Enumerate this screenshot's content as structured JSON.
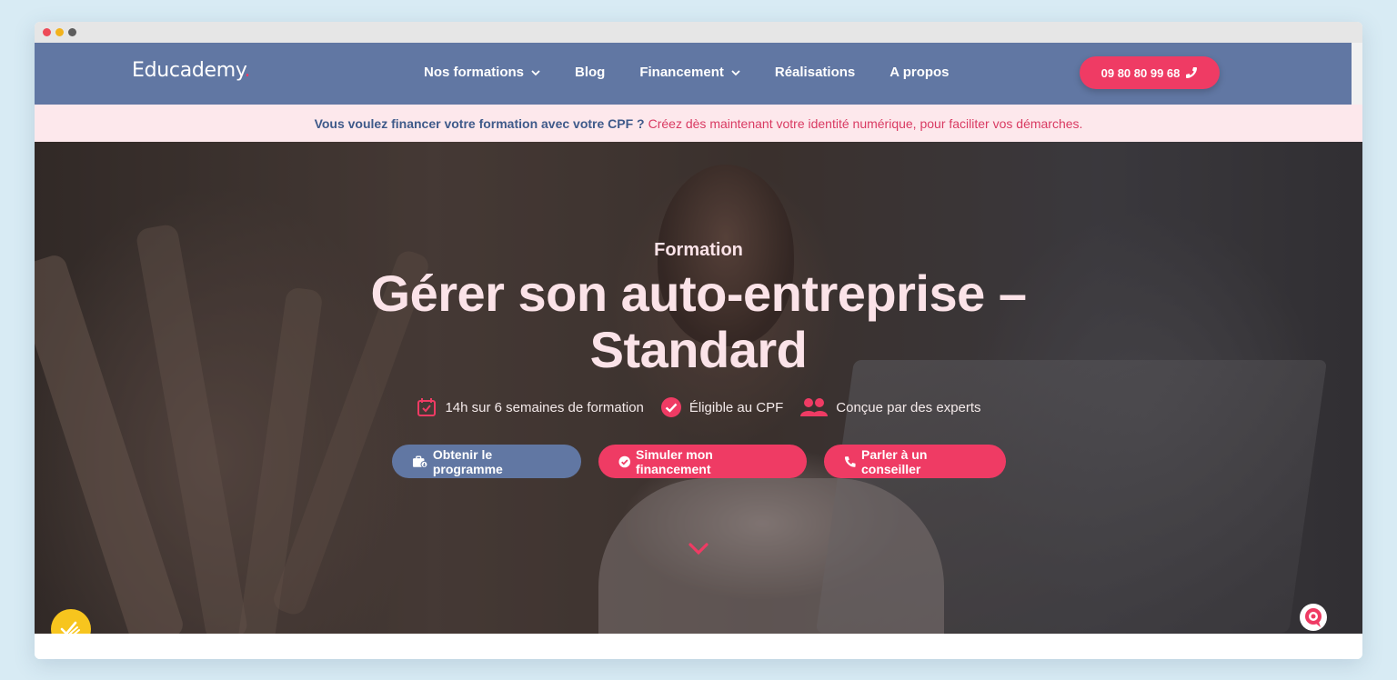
{
  "window": {
    "controls": [
      "close",
      "minimize",
      "maximize"
    ]
  },
  "nav": {
    "logo_text": "Educademy",
    "logo_dot": ".",
    "items": [
      {
        "label": "Nos formations",
        "has_dropdown": true
      },
      {
        "label": "Blog",
        "has_dropdown": false
      },
      {
        "label": "Financement",
        "has_dropdown": true
      },
      {
        "label": "Réalisations",
        "has_dropdown": false
      },
      {
        "label": "A propos",
        "has_dropdown": false
      }
    ],
    "phone": "09 80 80 99 68"
  },
  "banner": {
    "question": "Vous voulez financer votre formation avec votre CPF ?",
    "link": "Créez dès maintenant votre identité numérique, pour faciliter vos démarches."
  },
  "hero": {
    "kicker": "Formation",
    "title_line1": "Gérer son auto-entreprise –",
    "title_line2": "Standard",
    "features": [
      {
        "icon": "calendar-check-icon",
        "label": "14h sur 6 semaines de formation"
      },
      {
        "icon": "check-badge-icon",
        "label": "Éligible au CPF"
      },
      {
        "icon": "users-icon",
        "label": "Conçue par des experts"
      }
    ],
    "buttons": {
      "program": "Obtenir le programme",
      "simulate": "Simuler mon financement",
      "advisor": "Parler à un conseiller"
    }
  },
  "colors": {
    "nav_bg": "#6177a3",
    "accent_pink": "#ef3b64",
    "banner_bg": "#fde8ec",
    "hero_text": "#fbe3e8",
    "page_bg": "#d8ebf4"
  }
}
